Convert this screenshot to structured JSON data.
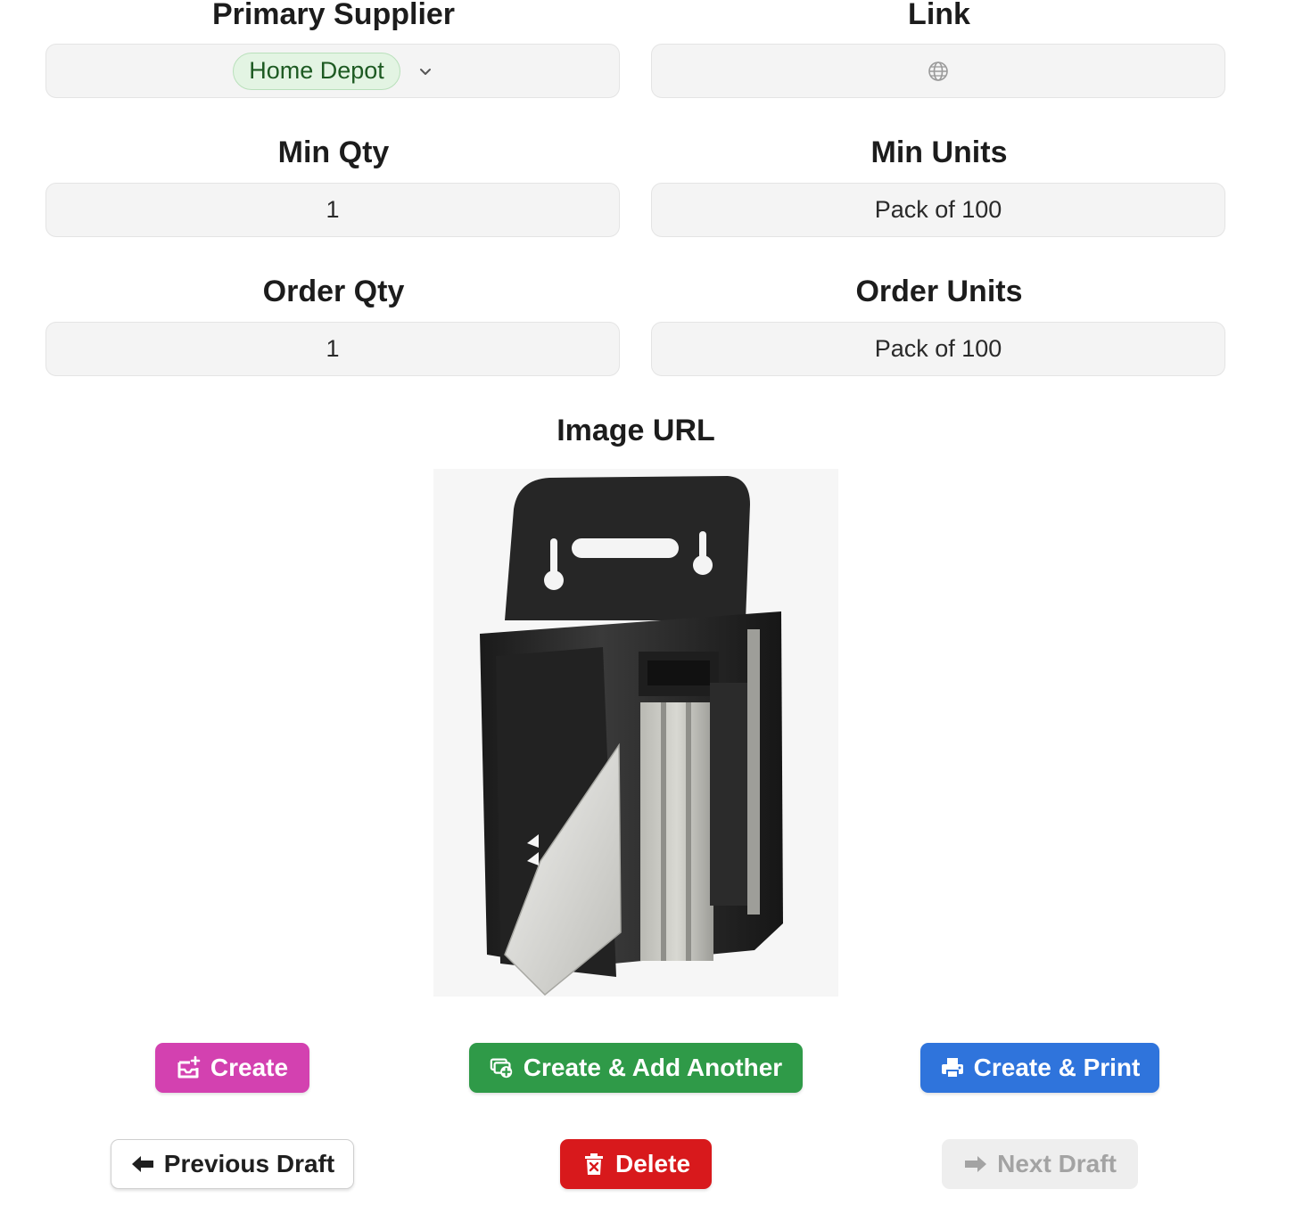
{
  "fields": {
    "primary_supplier": {
      "label": "Primary Supplier",
      "value": "Home Depot"
    },
    "link": {
      "label": "Link",
      "value": ""
    },
    "min_qty": {
      "label": "Min Qty",
      "value": "1"
    },
    "min_units": {
      "label": "Min Units",
      "value": "Pack of 100"
    },
    "order_qty": {
      "label": "Order Qty",
      "value": "1"
    },
    "order_units": {
      "label": "Order Units",
      "value": "Pack of 100"
    },
    "image_url": {
      "label": "Image URL"
    }
  },
  "buttons": {
    "create": "Create",
    "create_add_another": "Create & Add Another",
    "create_print": "Create & Print",
    "previous_draft": "Previous Draft",
    "delete": "Delete",
    "next_draft": "Next Draft"
  },
  "icons": {
    "supplier_dropdown": "chevron-down-icon",
    "link": "globe-icon",
    "create": "inbox-plus-icon",
    "create_add_another": "copy-plus-icon",
    "create_print": "printer-icon",
    "previous_draft": "arrow-left-icon",
    "delete": "trash-icon",
    "next_draft": "arrow-right-icon"
  },
  "colors": {
    "create": "#d341b0",
    "create_add_another": "#2f9a48",
    "create_print": "#2f74dc",
    "delete": "#d8191c",
    "supplier_tag_bg": "#e3f4e3",
    "supplier_tag_text": "#1d5a22"
  }
}
